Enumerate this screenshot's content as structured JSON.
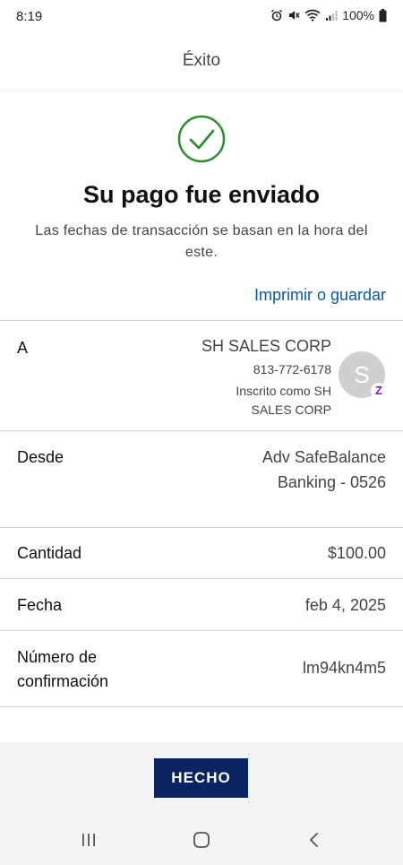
{
  "status_bar": {
    "time": "8:19",
    "battery": "100%"
  },
  "header": {
    "title": "Éxito"
  },
  "success": {
    "title": "Su pago fue enviado",
    "subtitle": "Las fechas de transacción se basan en la hora del este.",
    "print_link": "Imprimir o guardar",
    "accent_color": "#2e8b2e"
  },
  "details": {
    "to": {
      "label": "A",
      "name": "SH SALES CORP",
      "phone": "813-772-6178",
      "enrolled": "Inscrito como SH SALES CORP",
      "avatar_initial": "S",
      "badge": "Z"
    },
    "from": {
      "label": "Desde",
      "value_line1": "Adv SafeBalance",
      "value_line2": "Banking - 0526"
    },
    "amount": {
      "label": "Cantidad",
      "value": "$100.00"
    },
    "date": {
      "label": "Fecha",
      "value": "feb 4, 2025"
    },
    "confirmation": {
      "label_line1": "Número de",
      "label_line2": "confirmación",
      "value": "lm94kn4m5"
    }
  },
  "actions": {
    "done_label": "HECHO",
    "button_color": "#0a2463",
    "link_color": "#0a58a8"
  },
  "nav": {
    "icons": [
      "recent-apps-icon",
      "home-icon",
      "back-icon"
    ]
  }
}
